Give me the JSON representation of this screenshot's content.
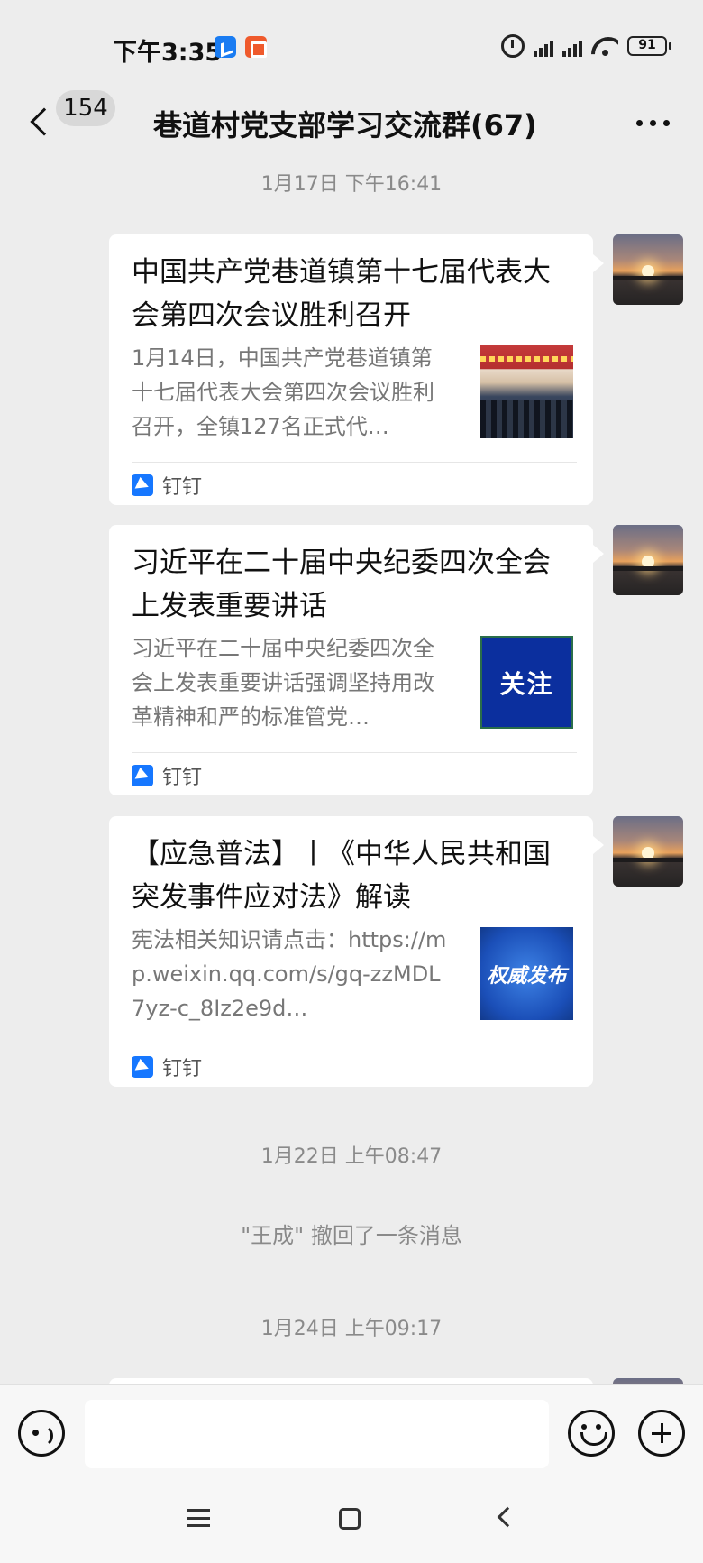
{
  "status_bar": {
    "time": "下午3:35",
    "battery": "91"
  },
  "header": {
    "unread_count": "154",
    "title": "巷道村党支部学习交流群(67)"
  },
  "messages": [
    {
      "timestamp": "1月17日 下午16:41",
      "title": "中国共产党巷道镇第十七届代表大会第四次会议胜利召开",
      "desc": "1月14日，中国共产党巷道镇第十七届代表大会第四次会议胜利召开，全镇127名正式代…",
      "source": "钉钉",
      "thumb_text": ""
    },
    {
      "title": "习近平在二十届中央纪委四次全会上发表重要讲话",
      "desc": "习近平在二十届中央纪委四次全会上发表重要讲话强调坚持用改革精神和严的标准管党…",
      "source": "钉钉",
      "thumb_text": "关注"
    },
    {
      "title": "【应急普法】丨《中华人民共和国突发事件应对法》解读",
      "desc": "宪法相关知识请点击：https://mp.weixin.qq.com/s/gq-zzMDL7yz-c_8Iz2e9d…",
      "source": "钉钉",
      "thumb_text": "权威发布"
    }
  ],
  "timestamp_2": "1月22日 上午08:47",
  "recall_notice": "\"王成\" 撤回了一条消息",
  "timestamp_3": "1月24日 上午09:17",
  "input": {
    "value": "",
    "placeholder": ""
  },
  "icons": {
    "back": "back-arrow-icon",
    "more": "more-dots-icon",
    "voice": "voice-icon",
    "emoji": "emoji-icon",
    "plus": "plus-icon",
    "source": "dingtalk-icon"
  },
  "colors": {
    "background": "#ededed",
    "card": "#ffffff",
    "secondary_text": "#777777",
    "timestamp_text": "#8a8a8a",
    "dingtalk_blue": "#1677ff"
  }
}
